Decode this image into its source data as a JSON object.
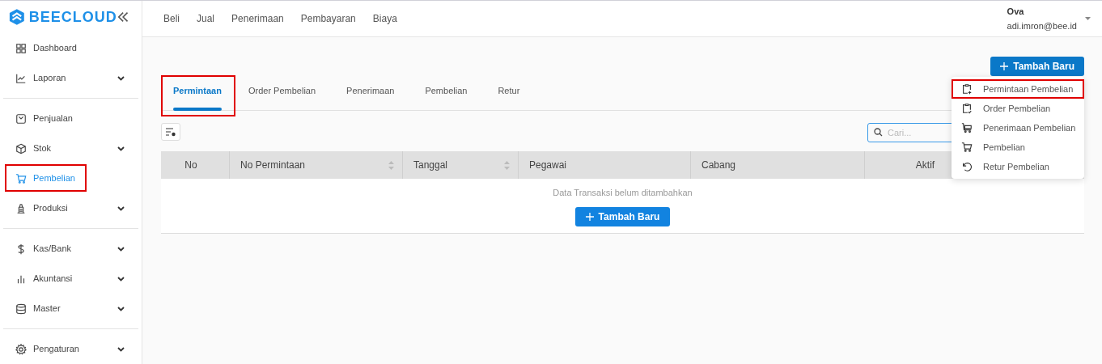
{
  "brand": {
    "name": "BEECLOUD"
  },
  "sidebar": {
    "groups": [
      [
        {
          "label": "Dashboard",
          "expandable": false,
          "selected": false,
          "highlighted": false
        },
        {
          "label": "Laporan",
          "expandable": true,
          "selected": false,
          "highlighted": false
        }
      ],
      [
        {
          "label": "Penjualan",
          "expandable": false,
          "selected": false,
          "highlighted": false
        },
        {
          "label": "Stok",
          "expandable": true,
          "selected": false,
          "highlighted": false
        },
        {
          "label": "Pembelian",
          "expandable": false,
          "selected": true,
          "highlighted": true
        },
        {
          "label": "Produksi",
          "expandable": true,
          "selected": false,
          "highlighted": false
        }
      ],
      [
        {
          "label": "Kas/Bank",
          "expandable": true,
          "selected": false,
          "highlighted": false
        },
        {
          "label": "Akuntansi",
          "expandable": true,
          "selected": false,
          "highlighted": false
        },
        {
          "label": "Master",
          "expandable": true,
          "selected": false,
          "highlighted": false
        }
      ],
      [
        {
          "label": "Pengaturan",
          "expandable": true,
          "selected": false,
          "highlighted": false
        }
      ]
    ]
  },
  "top_nav": [
    "Beli",
    "Jual",
    "Penerimaan",
    "Pembayaran",
    "Biaya"
  ],
  "user": {
    "name": "Ova",
    "email": "adi.imron@bee.id"
  },
  "add_button": "Tambah Baru",
  "tabs": [
    {
      "label": "Permintaan",
      "selected": true,
      "highlighted": true
    },
    {
      "label": "Order Pembelian",
      "selected": false,
      "highlighted": false
    },
    {
      "label": "Penerimaan",
      "selected": false,
      "highlighted": false
    },
    {
      "label": "Pembelian",
      "selected": false,
      "highlighted": false
    },
    {
      "label": "Retur",
      "selected": false,
      "highlighted": false
    }
  ],
  "search": {
    "placeholder": "Cari..."
  },
  "table": {
    "columns": [
      {
        "label": "No",
        "sortable": false
      },
      {
        "label": "No Permintaan",
        "sortable": true
      },
      {
        "label": "Tanggal",
        "sortable": true
      },
      {
        "label": "Pegawai",
        "sortable": false
      },
      {
        "label": "Cabang",
        "sortable": false
      },
      {
        "label": "Aktif",
        "sortable": false
      }
    ],
    "empty_message": "Data Transaksi belum ditambahkan",
    "empty_button": "Tambah Baru"
  },
  "add_menu": [
    {
      "label": "Permintaan Pembelian",
      "highlighted": true
    },
    {
      "label": "Order Pembelian",
      "highlighted": false
    },
    {
      "label": "Penerimaan Pembelian",
      "highlighted": false
    },
    {
      "label": "Pembelian",
      "highlighted": false
    },
    {
      "label": "Retur Pembelian",
      "highlighted": false
    }
  ]
}
